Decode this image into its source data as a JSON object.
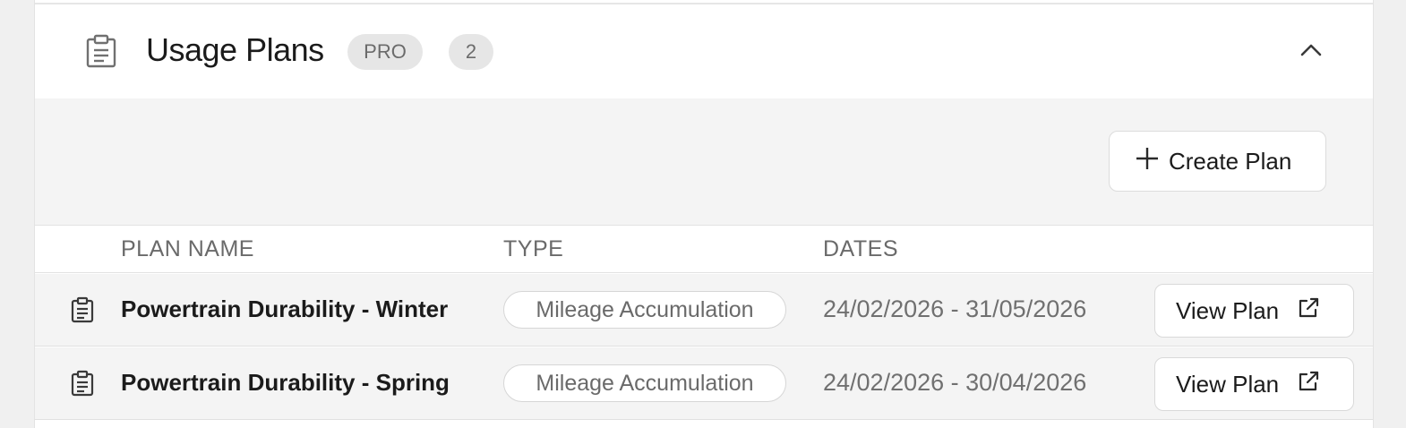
{
  "section": {
    "title": "Usage Plans",
    "tier_badge": "PRO",
    "count_badge": "2",
    "section_icon": "clipboard-icon",
    "collapse_icon": "chevron-up-icon"
  },
  "toolbar": {
    "create_label": "Create Plan",
    "create_icon": "plus-icon"
  },
  "table": {
    "columns": [
      "PLAN NAME",
      "TYPE",
      "DATES"
    ],
    "rows": [
      {
        "name": "Powertrain Durability - Winter",
        "type": "Mileage Accumulation",
        "dates": "24/02/2026 - 31/05/2026",
        "action": "View Plan"
      },
      {
        "name": "Powertrain Durability - Spring",
        "type": "Mileage Accumulation",
        "dates": "24/02/2026 - 30/04/2026",
        "action": "View Plan"
      }
    ],
    "row_icon": "clipboard-icon",
    "action_icon": "external-link-icon"
  },
  "colors": {
    "panel_bg": "#ffffff",
    "muted_bg": "#f4f4f4",
    "badge_bg": "#e6e6e6",
    "text_primary": "#1b1b1b",
    "text_muted": "#6a6a6a"
  }
}
